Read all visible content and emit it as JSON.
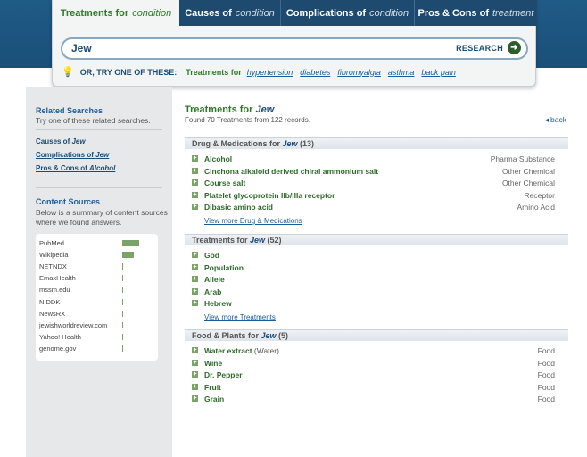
{
  "tabs": [
    {
      "label": "Treatments for",
      "sub": "condition"
    },
    {
      "label": "Causes of",
      "sub": "condition"
    },
    {
      "label": "Complications of",
      "sub": "condition"
    },
    {
      "label": "Pros & Cons of",
      "sub": "treatment"
    }
  ],
  "search": {
    "query": "Jew",
    "button": "RESEARCH"
  },
  "try": {
    "label": "OR, TRY ONE OF THESE:",
    "for_label": "Treatments for",
    "links": [
      "hypertension",
      "diabetes",
      "fibromyalgia",
      "asthma",
      "back pain"
    ]
  },
  "sidebar": {
    "related_heading": "Related Searches",
    "related_text": "Try one of these related searches.",
    "links": [
      {
        "prefix": "Causes of ",
        "term": "Jew"
      },
      {
        "prefix": "Complications of ",
        "term": "Jew"
      },
      {
        "prefix": "Pros & Cons of ",
        "term": "Alcohol"
      }
    ],
    "sources_heading": "Content Sources",
    "sources_text": "Below is a summary of content sources where we found answers.",
    "sources": [
      {
        "name": "PubMed",
        "share": 1.0
      },
      {
        "name": "Wikipedia",
        "share": 0.7
      },
      {
        "name": "NETNDX",
        "share": 0.05
      },
      {
        "name": "EmaxHealth",
        "share": 0.05
      },
      {
        "name": "mssm.edu",
        "share": 0.05
      },
      {
        "name": "NIDDK",
        "share": 0.05
      },
      {
        "name": "NewsRX",
        "share": 0.05
      },
      {
        "name": "jewishworldreview.com",
        "share": 0.05
      },
      {
        "name": "Yahoo! Health",
        "share": 0.05
      },
      {
        "name": "genome.gov",
        "share": 0.05
      }
    ]
  },
  "main": {
    "title_prefix": "Treatments for ",
    "title_term": "Jew",
    "found": "Found 70 Treatments from 122 records.",
    "back": "back",
    "sections": [
      {
        "heading": "Drug & Medications for ",
        "term": "Jew",
        "count": "(13)",
        "items": [
          {
            "name": "Alcohol",
            "extra": "",
            "type": "Pharma Substance"
          },
          {
            "name": "Cinchona alkaloid derived chiral ammonium salt",
            "extra": "",
            "type": "Other Chemical"
          },
          {
            "name": "Course salt",
            "extra": "",
            "type": "Other Chemical"
          },
          {
            "name": "Platelet glycoprotein IIb/IIIa receptor",
            "extra": "",
            "type": "Receptor"
          },
          {
            "name": "Dibasic amino acid",
            "extra": "",
            "type": "Amino Acid"
          }
        ],
        "more": "View more Drug & Medications"
      },
      {
        "heading": "Treatments for ",
        "term": "Jew",
        "count": "(52)",
        "items": [
          {
            "name": "God",
            "extra": "",
            "type": ""
          },
          {
            "name": "Population",
            "extra": "",
            "type": ""
          },
          {
            "name": "Allele",
            "extra": "",
            "type": ""
          },
          {
            "name": "Arab",
            "extra": "",
            "type": ""
          },
          {
            "name": "Hebrew",
            "extra": "",
            "type": ""
          }
        ],
        "more": "View more Treatments"
      },
      {
        "heading": "Food & Plants for ",
        "term": "Jew",
        "count": "(5)",
        "items": [
          {
            "name": "Water extract",
            "extra": " (Water)",
            "type": "Food"
          },
          {
            "name": "Wine",
            "extra": "",
            "type": "Food"
          },
          {
            "name": "Dr. Pepper",
            "extra": "",
            "type": "Food"
          },
          {
            "name": "Fruit",
            "extra": "",
            "type": "Food"
          },
          {
            "name": "Grain",
            "extra": "",
            "type": "Food"
          }
        ],
        "more": ""
      }
    ]
  }
}
